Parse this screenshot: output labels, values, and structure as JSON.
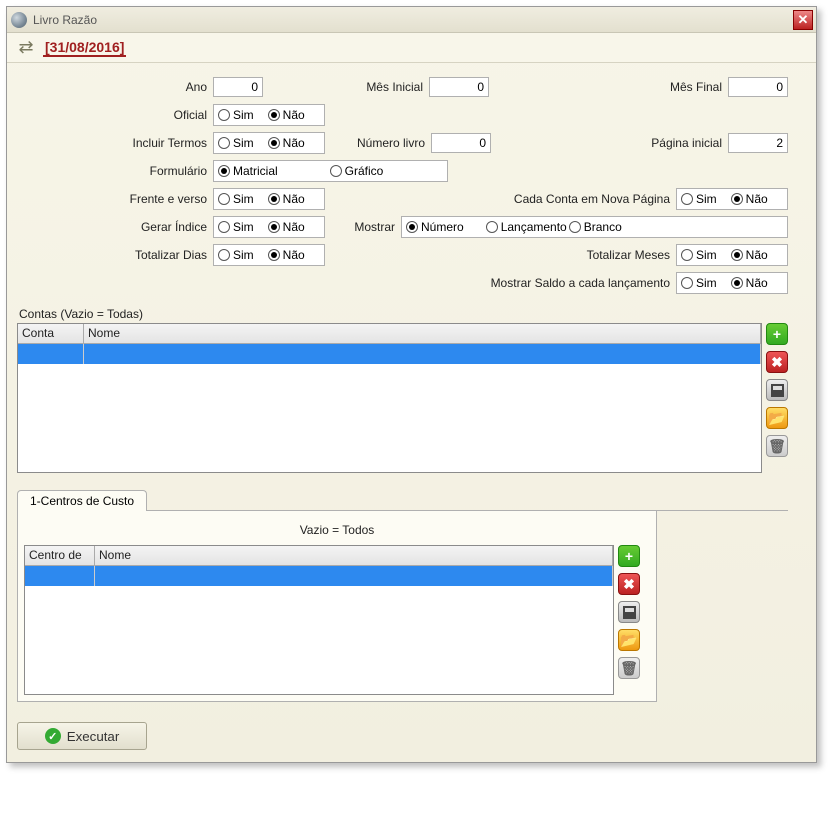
{
  "window": {
    "title": "Livro Razão",
    "close_icon": "✕"
  },
  "datebar": {
    "back_glyph": "⇄",
    "date": "[31/08/2016]"
  },
  "form": {
    "ano": {
      "label": "Ano",
      "value": "0"
    },
    "mes_inicial": {
      "label": "Mês Inicial",
      "value": "0"
    },
    "mes_final": {
      "label": "Mês Final",
      "value": "0"
    },
    "oficial": {
      "label": "Oficial",
      "sim": "Sim",
      "nao": "Não",
      "selected": "nao"
    },
    "incluir_termos": {
      "label": "Incluir Termos",
      "sim": "Sim",
      "nao": "Não",
      "selected": "nao"
    },
    "numero_livro": {
      "label": "Número livro",
      "value": "0"
    },
    "pagina_inicial": {
      "label": "Página inicial",
      "value": "2"
    },
    "formulario": {
      "label": "Formulário",
      "matricial": "Matricial",
      "grafico": "Gráfico",
      "selected": "matricial"
    },
    "frente_verso": {
      "label": "Frente e verso",
      "sim": "Sim",
      "nao": "Não",
      "selected": "nao"
    },
    "cada_conta": {
      "label": "Cada Conta em Nova Página",
      "sim": "Sim",
      "nao": "Não",
      "selected": "nao"
    },
    "gerar_indice": {
      "label": "Gerar Índice",
      "sim": "Sim",
      "nao": "Não",
      "selected": "nao"
    },
    "mostrar_opt": {
      "label": "Mostrar",
      "numero": "Número",
      "lancamento": "Lançamento",
      "branco": "Branco",
      "selected": "numero"
    },
    "totalizar_dias": {
      "label": "Totalizar Dias",
      "sim": "Sim",
      "nao": "Não",
      "selected": "nao"
    },
    "totalizar_meses": {
      "label": "Totalizar Meses",
      "sim": "Sim",
      "nao": "Não",
      "selected": "nao"
    },
    "mostrar_saldo": {
      "label": "Mostrar Saldo a cada lançamento",
      "sim": "Sim",
      "nao": "Não",
      "selected": "nao"
    }
  },
  "contas": {
    "section_label": "Contas (Vazio = Todas)",
    "col_conta": "Conta",
    "col_nome": "Nome"
  },
  "centros": {
    "tab_label": "1-Centros de Custo",
    "subtitle": "Vazio = Todos",
    "col_centro": "Centro de",
    "col_nome": "Nome"
  },
  "side_icons": {
    "add": "+",
    "del": "✖",
    "open": "📂",
    "trash": "🗑"
  },
  "footer": {
    "executar": "Executar",
    "check": "✓"
  }
}
